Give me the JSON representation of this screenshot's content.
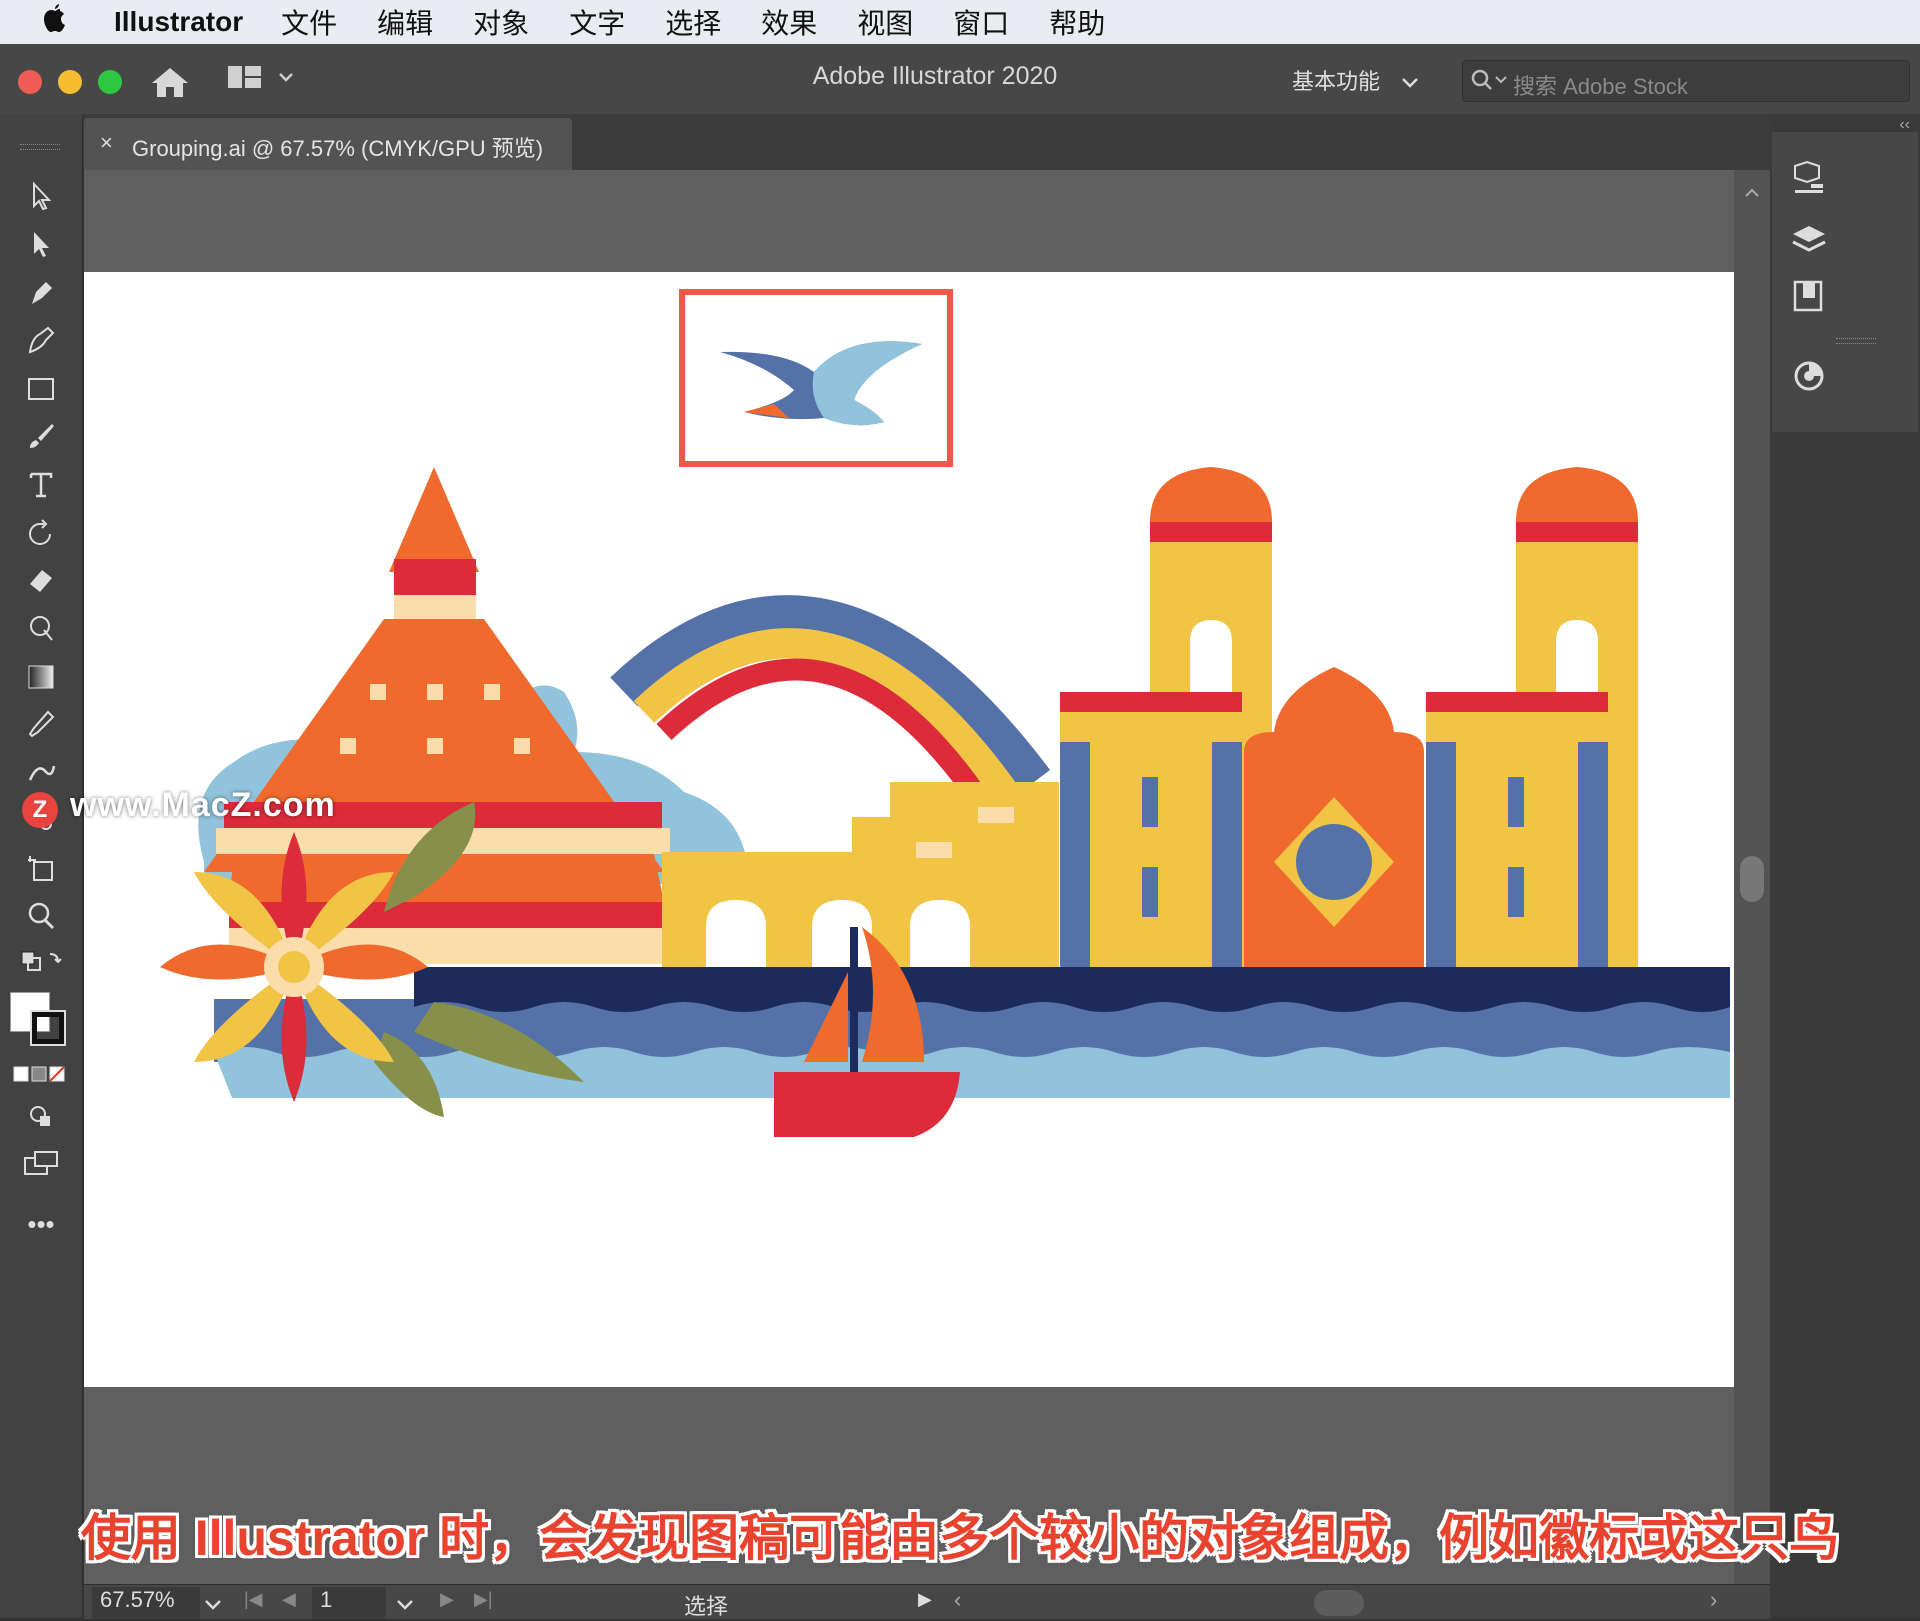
{
  "menubar": {
    "app": "Illustrator",
    "items": [
      "文件",
      "编辑",
      "对象",
      "文字",
      "选择",
      "效果",
      "视图",
      "窗口",
      "帮助"
    ]
  },
  "window": {
    "title": "Adobe Illustrator 2020",
    "workspace": "基本功能",
    "search_placeholder": "搜索 Adobe Stock"
  },
  "document_tab": {
    "close": "×",
    "label": "Grouping.ai @ 67.57% (CMYK/GPU 预览)"
  },
  "statusbar": {
    "zoom": "67.57%",
    "page": "1",
    "tool_label": "选择"
  },
  "overlay": {
    "watermark": "www.MacZ.com",
    "watermark_logo": "Z",
    "subtitle": "使用 Illustrator 时，会发现图稿可能由多个较小的对象组成，例如徽标或这只鸟"
  },
  "colors": {
    "orange": "#ef6a2c",
    "red": "#dc2c3c",
    "yellow": "#f1c445",
    "blue": "#5572a8",
    "lightblue": "#91c3dc",
    "navy": "#1c2b5c",
    "cream": "#fbdcab",
    "green": "#86904a",
    "highlight": "#ec5a4a"
  }
}
